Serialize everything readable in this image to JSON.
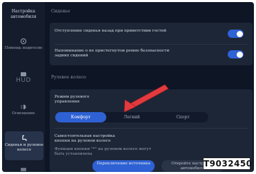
{
  "sidebar": {
    "title": "Настройка автомобиля",
    "items": [
      {
        "label": "Помощь водителю",
        "icon": "driver-assist-icon"
      },
      {
        "label": "HUD",
        "icon": "hud-icon"
      },
      {
        "label": "Освещение",
        "icon": "lighting-icon"
      },
      {
        "label": "Сиденья и рулевое колесо",
        "icon": "seat-icon",
        "active": true
      }
    ]
  },
  "seats": {
    "section_label": "Сиденье",
    "rows": [
      {
        "text": "Отступление сиденья назад при приветствии гостей",
        "on": true
      },
      {
        "text": "Напоминание о не пристегнутом ремне безопасности задних сидений",
        "on": true
      }
    ]
  },
  "steering": {
    "section_label": "Рулевое колесо",
    "mode_title": "Режим рулевого управления",
    "modes": [
      "Комфорт",
      "Легкий",
      "Спорт"
    ],
    "selected_mode": "Комфорт",
    "custom_title": "Самостоятельная настройка кнопки на рулевом колесе",
    "custom_desc": "Функция кнопки \"*\" на рулевом колесе могут быть установлена",
    "switch_source_button": "Переключение источника",
    "open_settings_button": "Откройте настройки автомобиля"
  },
  "image_code": "T9032450",
  "colors": {
    "background": "#0e1626",
    "sidebar": "#151d2d",
    "card": "#1d2637",
    "accent": "#2e61d4",
    "annotation_arrow": "#e23a3e"
  }
}
